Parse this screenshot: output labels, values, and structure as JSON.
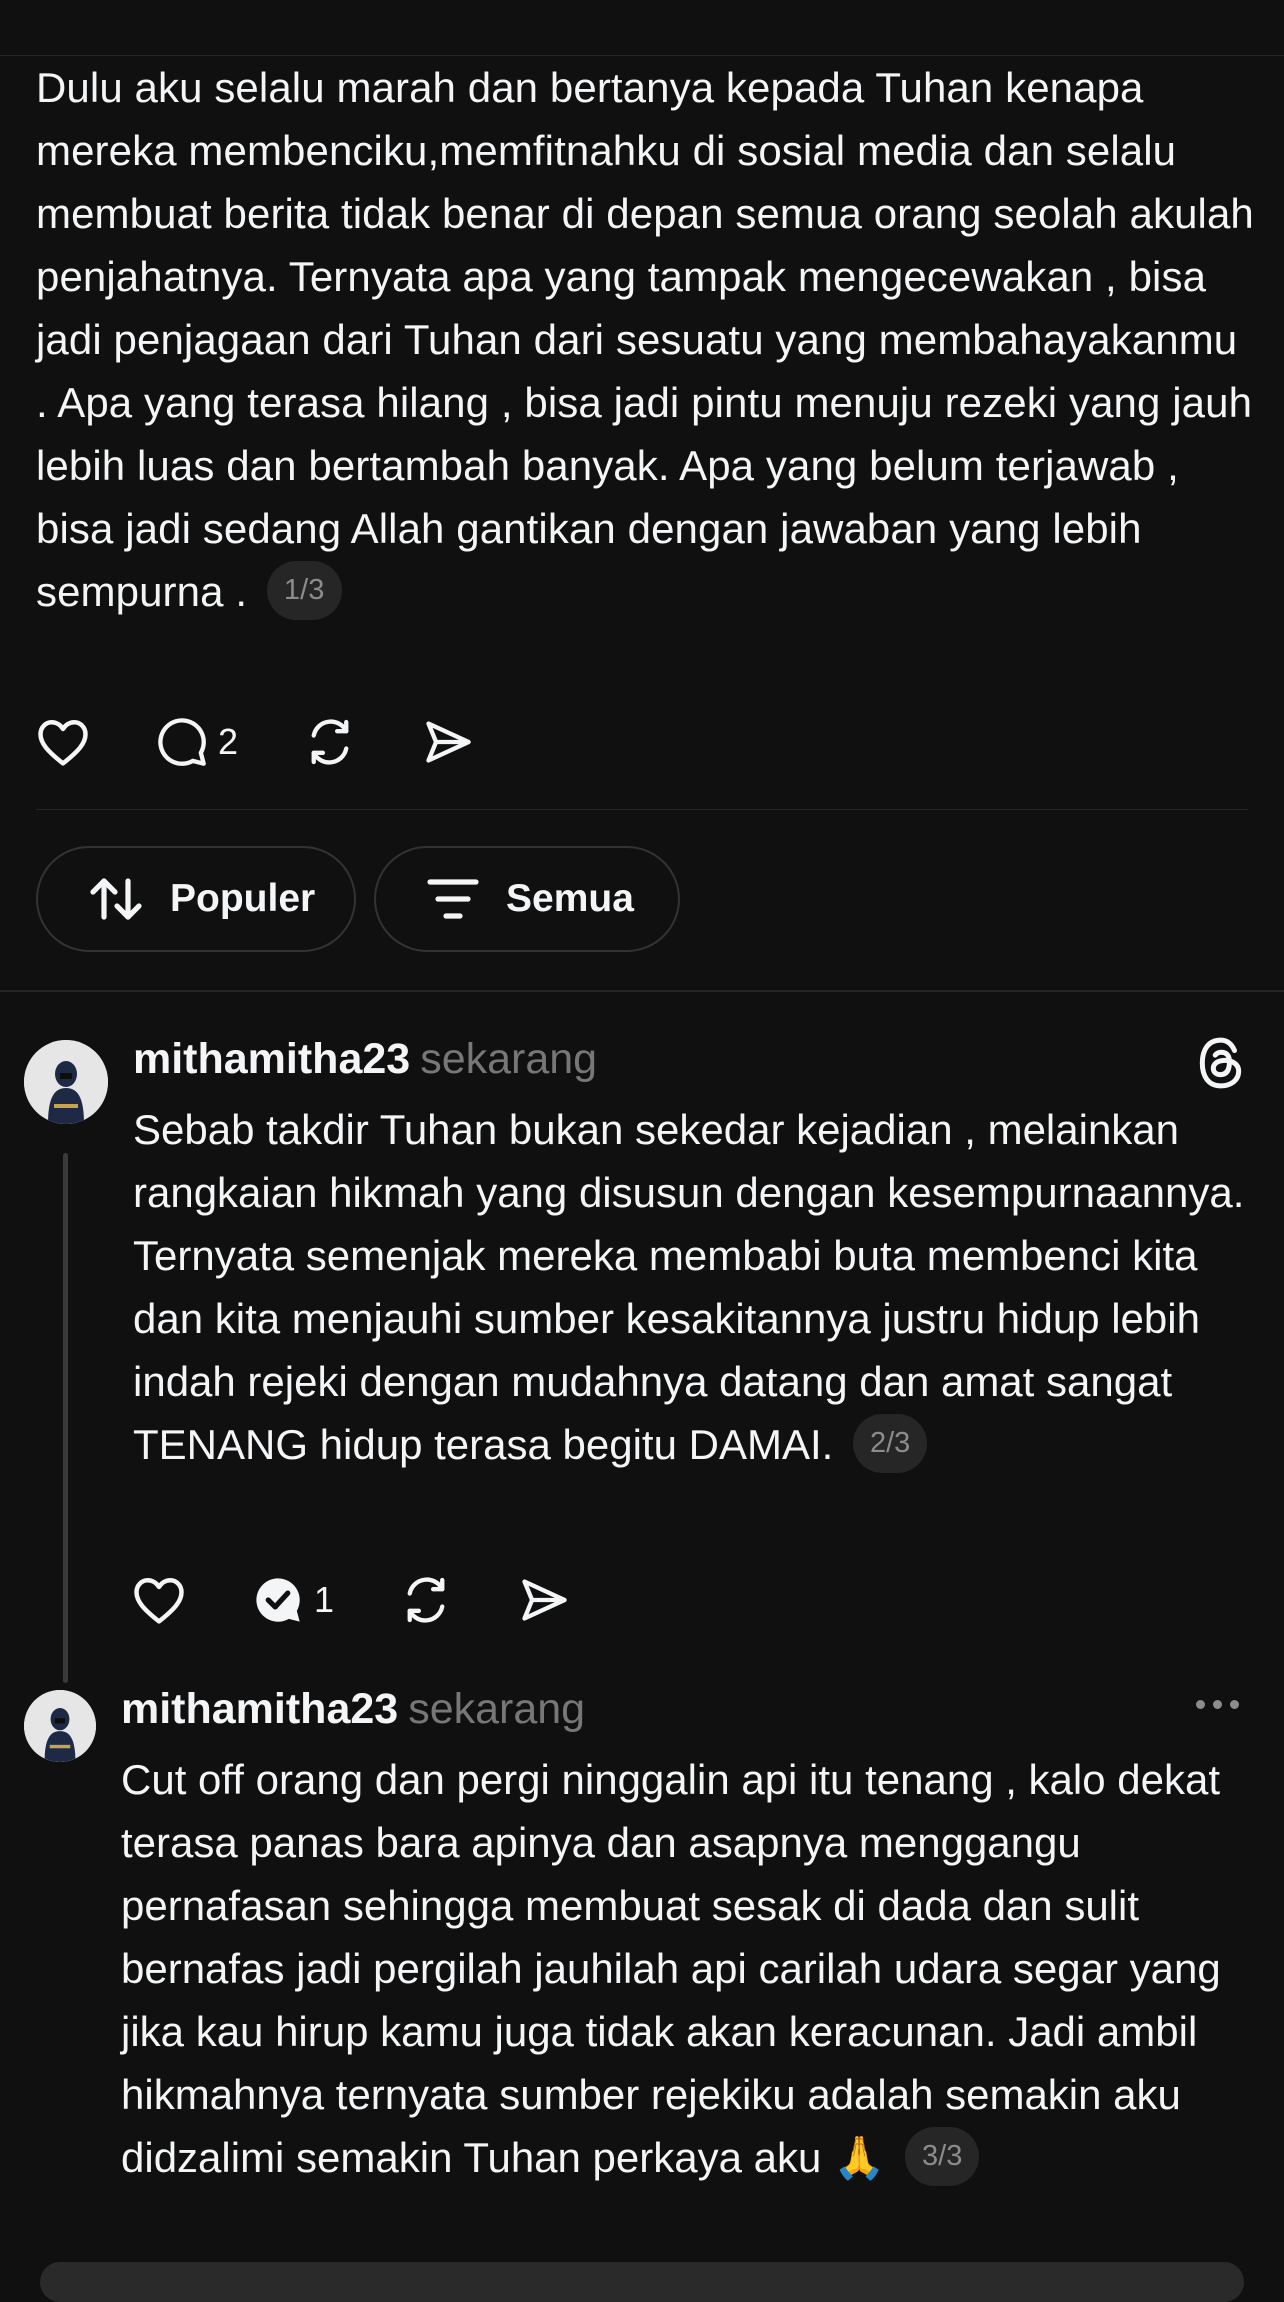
{
  "post": {
    "text": "Dulu aku selalu marah dan bertanya kepada Tuhan kenapa mereka membenciku,memfitnahku di sosial media dan selalu membuat berita tidak benar di depan semua orang seolah akulah penjahatnya. Ternyata apa yang tampak mengecewakan , bisa jadi penjagaan dari Tuhan dari sesuatu yang membahayakanmu . Apa yang terasa hilang , bisa jadi pintu menuju rezeki yang jauh lebih luas dan bertambah banyak. Apa yang belum terjawab , bisa jadi sedang Allah gantikan dengan jawaban yang lebih sempurna .",
    "page": "1/3",
    "reply_count": "2"
  },
  "filters": {
    "sort_label": "Populer",
    "filter_label": "Semua"
  },
  "comments": [
    {
      "username": "mithamitha23",
      "time": "sekarang",
      "text": "Sebab takdir Tuhan bukan sekedar kejadian , melainkan rangkaian hikmah yang disusun dengan kesempurnaannya. Ternyata semenjak mereka membabi buta membenci kita dan kita menjauhi sumber kesakitannya justru hidup lebih indah rejeki dengan mudahnya datang dan amat sangat TENANG hidup terasa begitu DAMAI.",
      "page": "2/3",
      "reply_count": "1"
    },
    {
      "username": "mithamitha23",
      "time": "sekarang",
      "text": "Cut off orang dan pergi ninggalin api itu tenang , kalo dekat terasa panas bara apinya dan asapnya menggangu pernafasan sehingga membuat sesak di dada dan sulit bernafas jadi pergilah jauhilah api carilah udara segar yang jika kau hirup kamu juga tidak akan keracunan. Jadi ambil hikmahnya ternyata sumber rejekiku adalah semakin aku didzalimi semakin Tuhan perkaya aku",
      "emoji": "🙏",
      "page": "3/3"
    }
  ],
  "icons": {
    "like": "heart-icon",
    "reply": "comment-icon",
    "repost": "repost-icon",
    "share": "send-icon",
    "sort": "sort-arrows-icon",
    "filter": "filter-lines-icon",
    "threads": "threads-logo-icon",
    "more": "more-dots-icon"
  },
  "colors": {
    "background": "#101010",
    "text": "#f3f5f7",
    "muted": "#777777",
    "divider": "#262626"
  }
}
